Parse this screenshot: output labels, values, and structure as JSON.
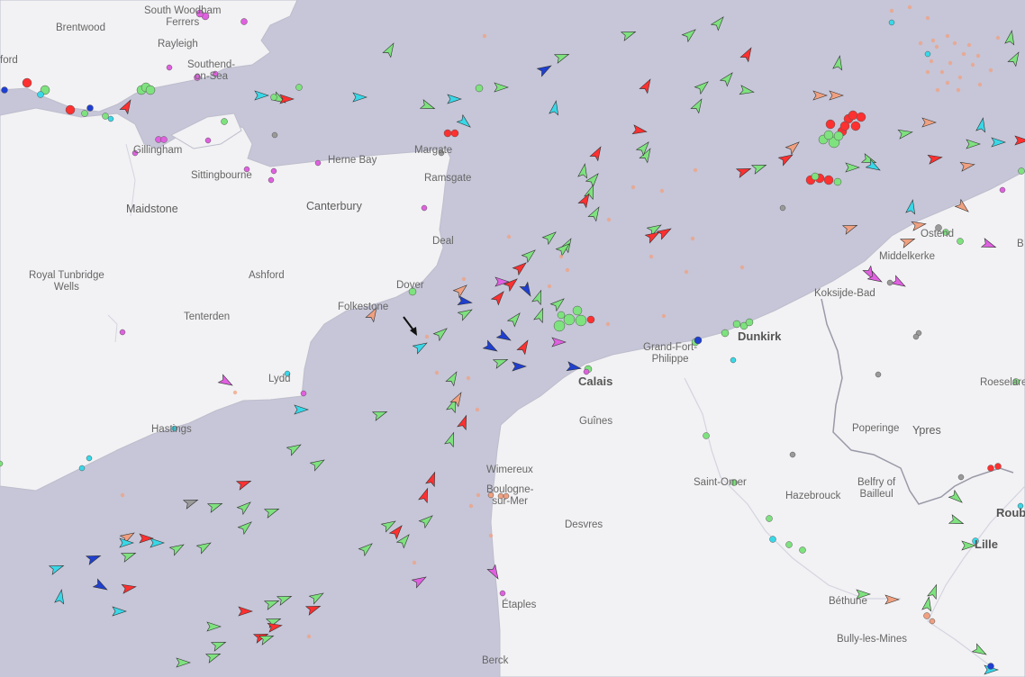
{
  "map": {
    "colors": {
      "sea": "#c6c6d8",
      "land": "#f2f2f4",
      "coast_line": "#b8b8c8",
      "cargo": "#7ee27e",
      "tanker": "#ff3030",
      "passenger": "#1f3fd0",
      "tug": "#38d8e8",
      "pleasure": "#e060e0",
      "fishing": "#f0a080",
      "unknown": "#9a9a9a"
    },
    "labels": {
      "south_woodham": "South Woodham\nFerrers",
      "brentwood": "Brentwood",
      "ford": "ford",
      "rayleigh": "Rayleigh",
      "southend": "Southend-\non-Sea",
      "gillingham": "Gillingham",
      "sittingbourne": "Sittingbourne",
      "herne_bay": "Herne Bay",
      "margate": "Margate",
      "ramsgate": "Ramsgate",
      "maidstone": "Maidstone",
      "canterbury": "Canterbury",
      "deal": "Deal",
      "royal_tunbridge": "Royal Tunbridge\nWells",
      "ashford": "Ashford",
      "dover": "Dover",
      "folkestone": "Folkestone",
      "tenterden": "Tenterden",
      "lydd": "Lydd",
      "hastings": "Hastings",
      "ostend": "Ostend",
      "middelkerke": "Middelkerke",
      "koksijde": "Koksijde-Bad",
      "dunkirk": "Dunkirk",
      "grand_fort": "Grand-Fort-\nPhilippe",
      "calais": "Calais",
      "guines": "Guînes",
      "poperinge": "Poperinge",
      "ypres": "Ypres",
      "roeselare": "Roeselare",
      "wimereux": "Wimereux",
      "boulogne": "Boulogne-\nsur-Mer",
      "desvres": "Desvres",
      "saint_omer": "Saint-Omer",
      "hazebrouck": "Hazebrouck",
      "belfry": "Belfry of\nBailleul",
      "roubaix": "Roub",
      "lille": "Lille",
      "etaples": "Étaples",
      "bethune": "Béthune",
      "bully": "Bully-les-Mines",
      "berck": "Berck",
      "bruges_edge": "B"
    },
    "selected_vessel_marker": "arrow-pointer-icon"
  }
}
